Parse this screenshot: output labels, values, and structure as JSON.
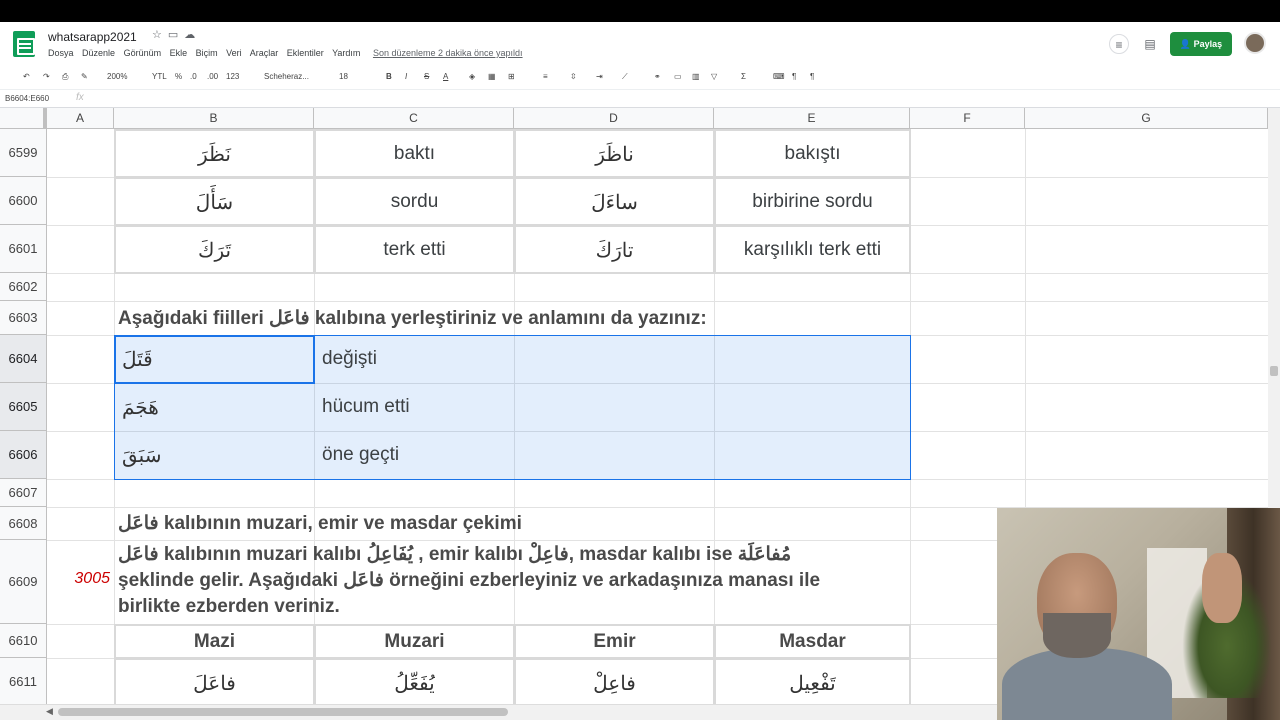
{
  "app": {
    "doc_title": "whatsarapp2021",
    "menus": [
      "Dosya",
      "Düzenle",
      "Görünüm",
      "Ekle",
      "Biçim",
      "Veri",
      "Araçlar",
      "Eklentiler",
      "Yardım"
    ],
    "last_edit": "Son düzenleme 2 dakika önce yapıldı",
    "share_label": "Paylaş"
  },
  "toolbar": {
    "zoom": "200%",
    "currency": "YTL",
    "percent": "%",
    "decimal_less": ".0",
    "decimal_more": ".00",
    "format_more": "123",
    "font": "Scheheraz...",
    "font_size": "18"
  },
  "formula_bar": {
    "name_box": "B6604:E660",
    "fx": "fx"
  },
  "columns": [
    "A",
    "B",
    "C",
    "D",
    "E",
    "F",
    "G"
  ],
  "rows": [
    {
      "num": "6599"
    },
    {
      "num": "6600"
    },
    {
      "num": "6601"
    },
    {
      "num": "6602"
    },
    {
      "num": "6603"
    },
    {
      "num": "6604"
    },
    {
      "num": "6605"
    },
    {
      "num": "6606"
    },
    {
      "num": "6607"
    },
    {
      "num": "6608"
    },
    {
      "num": "6609"
    },
    {
      "num": "6610"
    },
    {
      "num": "6611"
    }
  ],
  "table1": [
    {
      "b": "نَظَرَ",
      "c": "baktı",
      "d": "ناظَرَ",
      "e": "bakıştı"
    },
    {
      "b": "سَأَلَ",
      "c": "sordu",
      "d": "ساءَلَ",
      "e": "birbirine sordu"
    },
    {
      "b": "تَرَكَ",
      "c": "terk etti",
      "d": "تارَكَ",
      "e": "karşılıklı terk etti"
    }
  ],
  "instruction_6603": "Aşağıdaki fiilleri فاعَل kalıbına yerleştiriniz ve anlamını da yazınız:",
  "exercise": [
    {
      "b": "قَتَلَ",
      "c": "değişti"
    },
    {
      "b": "هَجَمَ",
      "c": "hücum etti"
    },
    {
      "b": "سَبَقَ",
      "c": "öne geçti"
    }
  ],
  "heading_6608": "فاعَل kalıbının muzari, emir ve masdar çekimi",
  "para_6609": {
    "number": "3005",
    "line1": "فاعَل kalıbının muzari kalıbı يُفَاعِلُ , emir kalıbı فاعِلْ, masdar kalıbı ise مُفاعَلَة",
    "line2": "şeklinde gelir. Aşağıdaki فاعَل örneğini ezberleyiniz ve arkadaşınıza manası ile",
    "line3": "birlikte ezberden veriniz."
  },
  "table2_headers": [
    "Mazi",
    "Muzari",
    "Emir",
    "Masdar"
  ],
  "table2_row": [
    "فاعَلَ",
    "يُفَعِّلُ",
    "فاعِلْ",
    "تَفْعِيل"
  ]
}
